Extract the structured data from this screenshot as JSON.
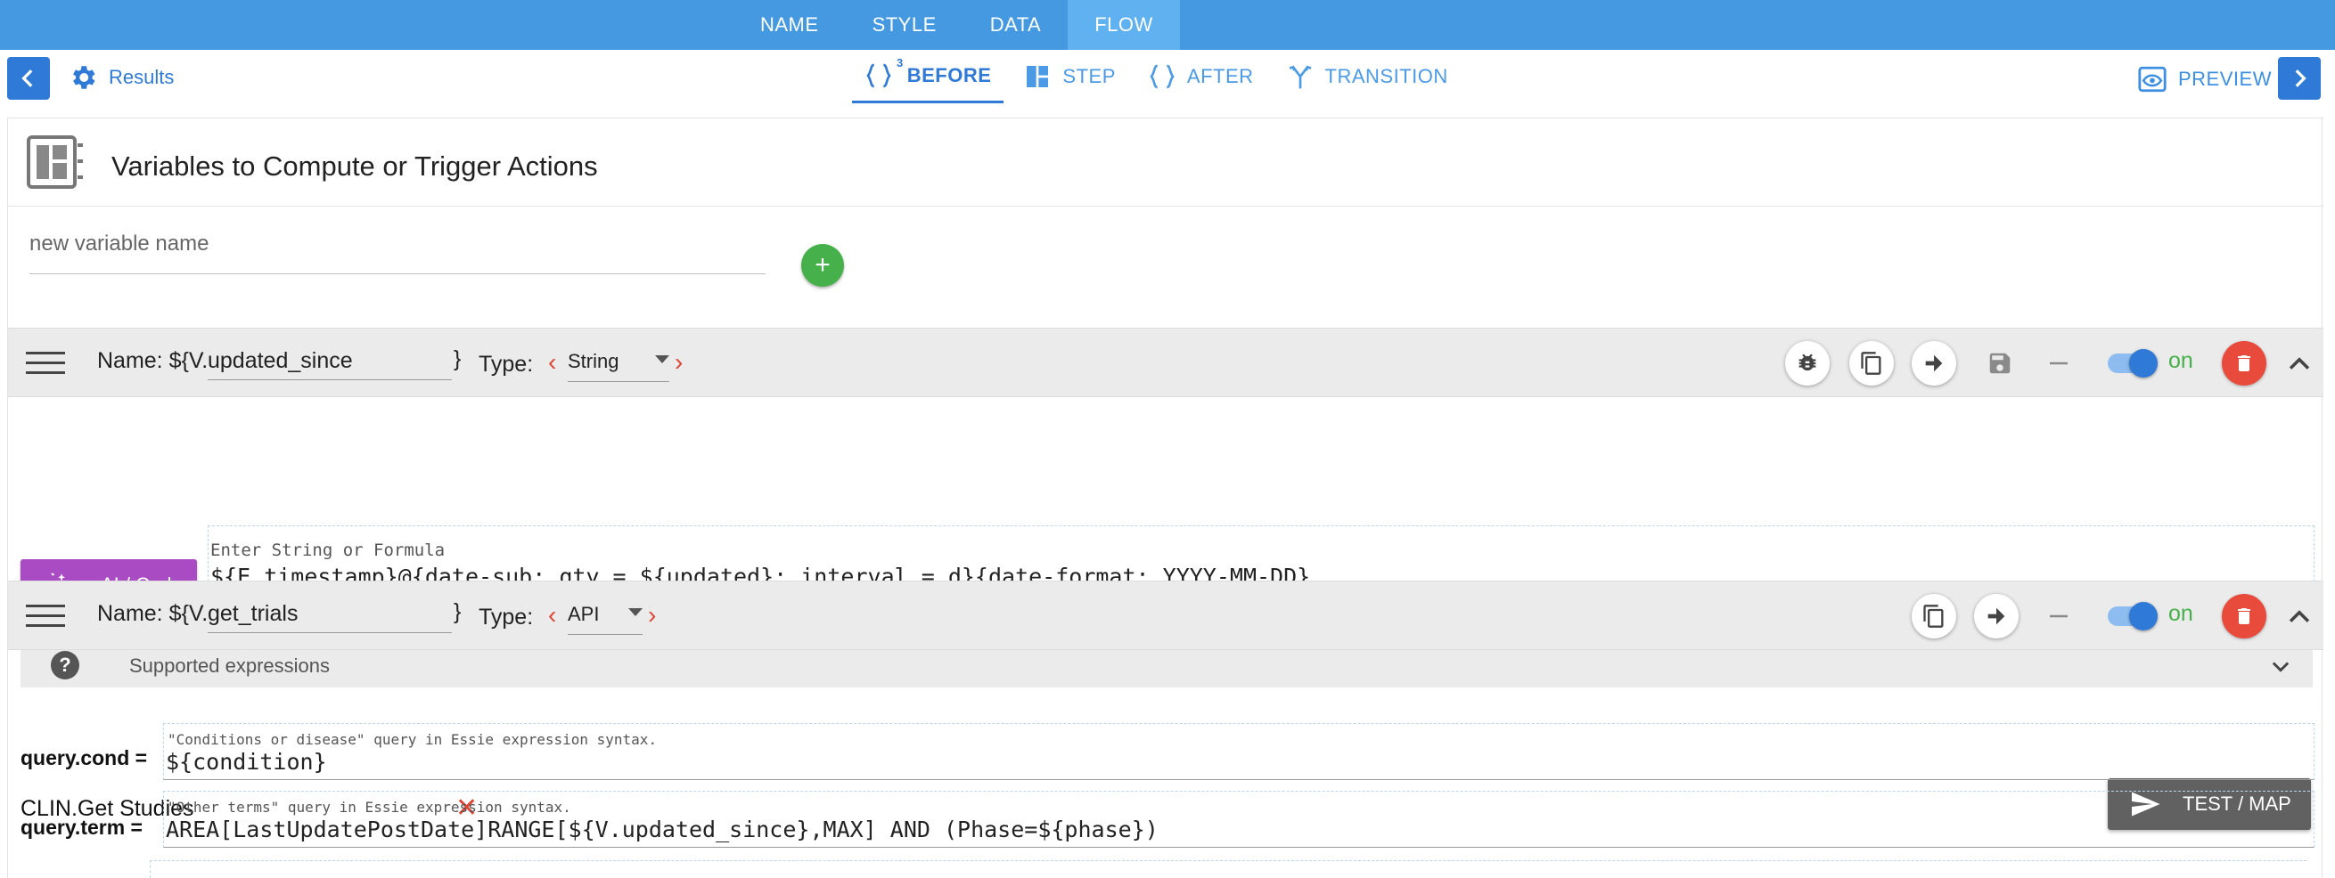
{
  "top_tabs": [
    {
      "label": "NAME"
    },
    {
      "label": "STYLE"
    },
    {
      "label": "DATA"
    },
    {
      "label": "FLOW",
      "active": true
    }
  ],
  "results_label": "Results",
  "preview_label": "PREVIEW",
  "flow_tabs": {
    "before": {
      "label": "BEFORE",
      "badge": "3"
    },
    "step": {
      "label": "STEP"
    },
    "after": {
      "label": "AFTER"
    },
    "transition": {
      "label": "TRANSITION"
    }
  },
  "section_title": "Variables to Compute or Trigger Actions",
  "new_variable": {
    "placeholder": "new variable name",
    "add_symbol": "+"
  },
  "variables": [
    {
      "name_label": "Name: ${V.",
      "name_value": "updated_since",
      "name_close": "}",
      "type_label": "Type:",
      "type_value": "String",
      "on_label": "on",
      "ai_label": "AI / Code",
      "formula_hint": "Enter String or Formula",
      "formula_value": "${E.timestamp}@{date-sub: qty = ${updated}; interval = d}{date-format: YYYY-MM-DD}",
      "supported_label": "Supported expressions"
    },
    {
      "name_label": "Name: ${V.",
      "name_value": "get_trials",
      "name_close": "}",
      "type_label": "Type:",
      "type_value": "API",
      "on_label": "on",
      "api_name": "CLIN.Get Studies",
      "test_label": "TEST / MAP",
      "params": [
        {
          "label": "query.cond =",
          "hint": "\"Conditions or disease\" query in Essie expression syntax.",
          "value": "${condition}"
        },
        {
          "label": "query.term =",
          "hint": "\"Other terms\" query in Essie expression syntax.",
          "value": "AREA[LastUpdatePostDate]RANGE[${V.updated_since},MAX] AND (Phase=${phase})"
        }
      ]
    }
  ],
  "colors": {
    "primary": "#2f7ad6",
    "topbar": "#4499e0",
    "add_green": "#46b04a",
    "ai_purple": "#a94cc4",
    "delete_red": "#e84a3c",
    "test_grey": "#616161"
  },
  "icons": [
    "chevron-left-icon",
    "gear-icon",
    "braces-icon",
    "layout-icon",
    "fork-icon",
    "eye-icon",
    "chevron-right-icon",
    "dashboard-icon",
    "bug-icon",
    "copy-icon",
    "arrow-right-icon",
    "save-icon",
    "minus-icon",
    "trash-icon",
    "chevron-up-icon",
    "chevron-down-icon",
    "magic-wand-icon",
    "send-icon",
    "help-icon"
  ]
}
